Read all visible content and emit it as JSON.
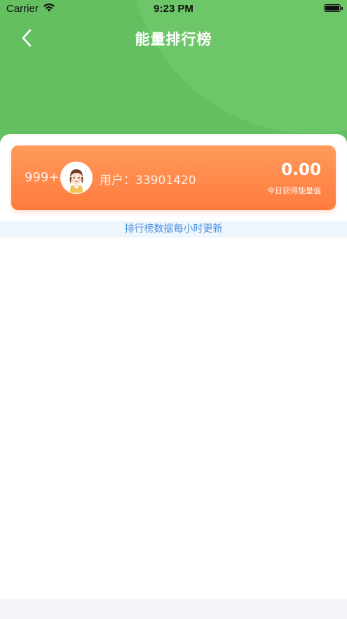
{
  "status_bar": {
    "carrier": "Carrier",
    "time": "9:23 PM"
  },
  "nav": {
    "title": "能量排行榜",
    "back_icon": "chevron-left-icon"
  },
  "my_rank": {
    "rank": "999+",
    "user_label": "用户：33901420",
    "energy_value": "0.00",
    "energy_label": "今日获得能量值"
  },
  "update_note": "排行榜数据每小时更新",
  "colors": {
    "header_green": "#63bf5f",
    "card_orange": "#ff8a4c",
    "note_blue": "#4a90e2"
  }
}
